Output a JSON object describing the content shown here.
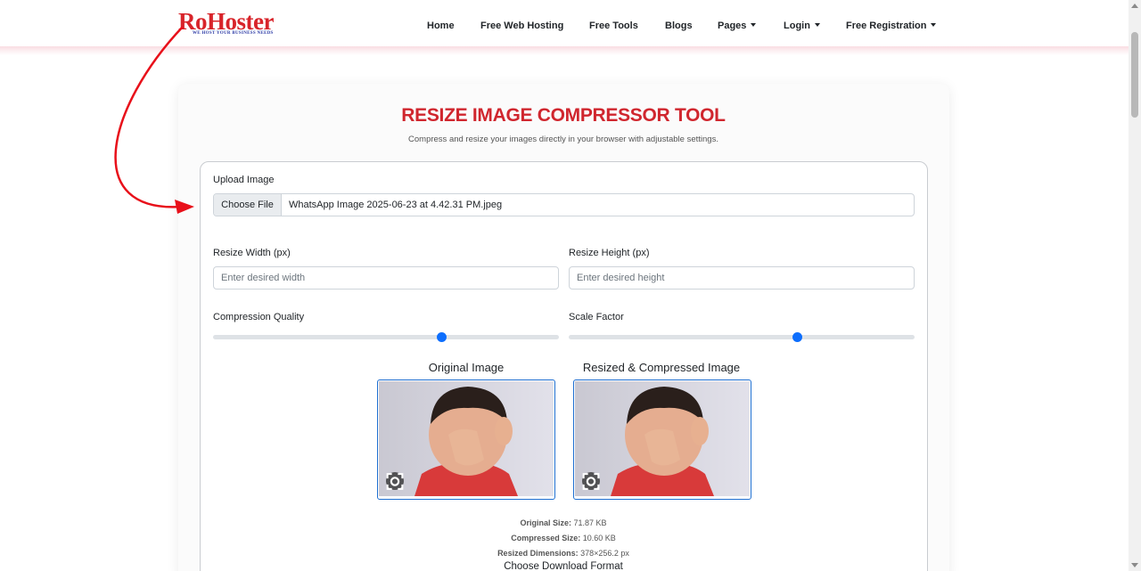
{
  "logo": {
    "text": "RoHoster",
    "tagline": "WE HOST YOUR BUSINESS NEEDS"
  },
  "nav": {
    "items": [
      {
        "label": "Home",
        "dropdown": false
      },
      {
        "label": "Free Web Hosting",
        "dropdown": false
      },
      {
        "label": "Free Tools",
        "dropdown": false
      },
      {
        "label": "Blogs",
        "dropdown": false
      },
      {
        "label": "Pages",
        "dropdown": true
      },
      {
        "label": "Login",
        "dropdown": true
      },
      {
        "label": "Free Registration",
        "dropdown": true
      }
    ]
  },
  "tool": {
    "title": "RESIZE IMAGE COMPRESSOR TOOL",
    "subtitle": "Compress and resize your images directly in your browser with adjustable settings."
  },
  "upload": {
    "label": "Upload Image",
    "button_label": "Choose File",
    "file_name": "WhatsApp Image 2025-06-23 at 4.42.31 PM.jpeg"
  },
  "resize": {
    "width_label": "Resize Width (px)",
    "width_placeholder": "Enter desired width",
    "height_label": "Resize Height (px)",
    "height_placeholder": "Enter desired height"
  },
  "sliders": {
    "quality_label": "Compression Quality",
    "quality_fraction": 0.66,
    "scale_label": "Scale Factor",
    "scale_fraction": 0.66
  },
  "preview": {
    "original_title": "Original Image",
    "resized_title": "Resized & Compressed Image"
  },
  "stats": {
    "original_size_label": "Original Size:",
    "original_size_value": "71.87 KB",
    "compressed_size_label": "Compressed Size:",
    "compressed_size_value": "10.60 KB",
    "dimensions_label": "Resized Dimensions:",
    "dimensions_value": "378×256.2 px"
  },
  "download": {
    "title": "Choose Download Format"
  },
  "colors": {
    "brand_red": "#d0262e",
    "accent_blue": "#0d6efd",
    "annotation_arrow": "#e8101a"
  },
  "icons": {
    "lens": "visual-search-icon",
    "caret": "caret-down-icon"
  }
}
